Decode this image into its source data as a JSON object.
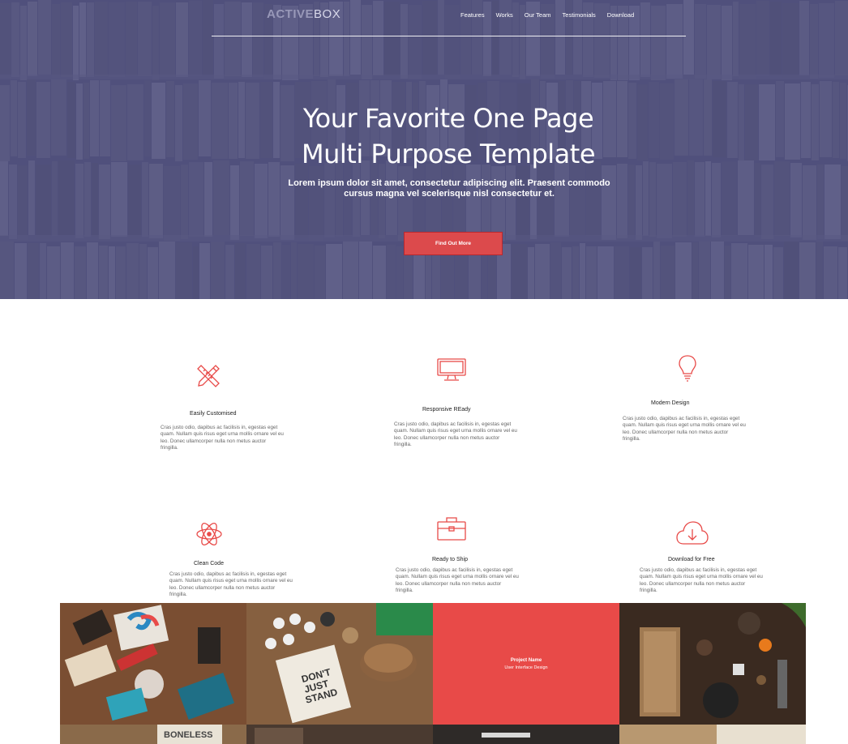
{
  "header": {
    "logo_part1": "ACTIVE",
    "logo_part2": "BOX",
    "nav": [
      "Features",
      "Works",
      "Our Team",
      "Testimonials",
      "Download"
    ]
  },
  "hero": {
    "title_line1": "Your Favorite One Page",
    "title_line2": "Multi Purpose Template",
    "subtitle": "Lorem ipsum dolor sit amet, consectetur adipiscing elit. Praesent commodo cursus magna vel scelerisque nisl consectetur et.",
    "cta_label": "Find Out More"
  },
  "features": [
    {
      "title": "Easily Customised",
      "icon": "pencil-ruler-icon",
      "text": "Cras justo odio, dapibus ac facilisis in, egestas eget quam. Nullam quis risus eget urna mollis ornare vel eu leo. Donec ullamcorper nulla non metus auctor fringilla."
    },
    {
      "title": "Responsive REady",
      "icon": "monitor-icon",
      "text": "Cras justo odio, dapibus ac facilisis in, egestas eget quam. Nullam quis risus eget urna mollis ornare vel eu leo. Donec ullamcorper nulla non metus auctor fringilla."
    },
    {
      "title": "Modern Design",
      "icon": "lightbulb-icon",
      "text": "Cras justo odio, dapibus ac facilisis in, egestas eget quam. Nullam quis risus eget urna mollis ornare vel eu leo. Donec ullamcorper nulla non metus auctor fringilla."
    },
    {
      "title": "Clean Code",
      "icon": "atom-icon",
      "text": "Cras justo odio, dapibus ac facilisis in, egestas eget quam. Nullam quis risus eget urna mollis ornare vel eu leo. Donec ullamcorper nulla non metus auctor fringilla."
    },
    {
      "title": "Ready to Ship",
      "icon": "briefcase-icon",
      "text": "Cras justo odio, dapibus ac facilisis in, egestas eget quam. Nullam quis risus eget urna mollis ornare vel eu leo. Donec ullamcorper nulla non metus auctor fringilla."
    },
    {
      "title": "Download for Free",
      "icon": "cloud-download-icon",
      "text": "Cras justo odio, dapibus ac facilisis in, egestas eget quam. Nullam quis risus eget urna mollis ornare vel eu leo. Donec ullamcorper nulla non metus auctor fringilla."
    }
  ],
  "portfolio": {
    "hover_project_name": "Project Name",
    "hover_project_category": "User Interface Design"
  },
  "colors": {
    "accent": "#e84a48",
    "hero_overlay": "#4f4f77"
  }
}
